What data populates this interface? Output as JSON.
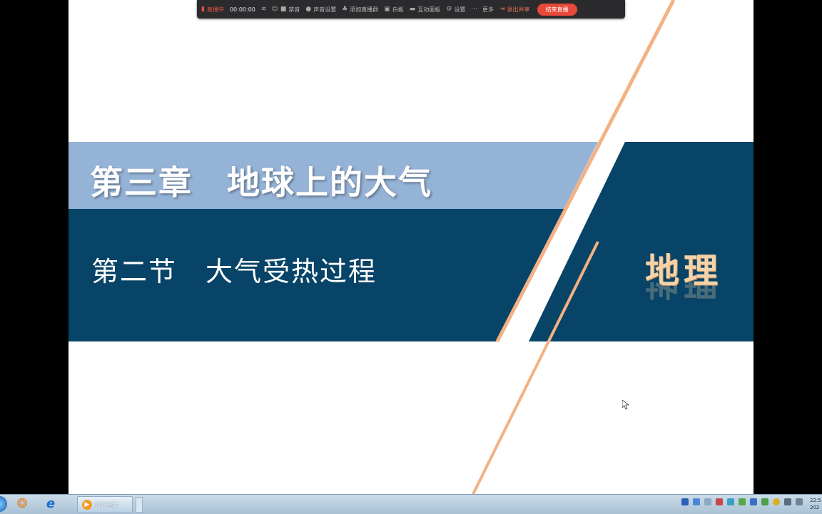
{
  "toolbar": {
    "live_status": "直播中",
    "timer": "00:00:00",
    "mute": "禁音",
    "sound_settings": "声音设置",
    "add_group": "添加直播群",
    "whiteboard": "白板",
    "interaction_panel": "互动面板",
    "settings": "设置",
    "more": "更多",
    "exit_share": "退出共享",
    "end_live": "结束直播"
  },
  "slide": {
    "chapter_title": "第三章　地球上的大气",
    "section_title": "第二节　大气受热过程",
    "subject_logo": "地理"
  },
  "taskbar": {
    "task_item_label": "钉钉直播",
    "clock_time": "22:5",
    "clock_date": "202"
  },
  "colors": {
    "band_light": "#95b3d7",
    "band_dark": "#084467",
    "accent_line": "#f4b183",
    "end_button": "#e8493a"
  }
}
